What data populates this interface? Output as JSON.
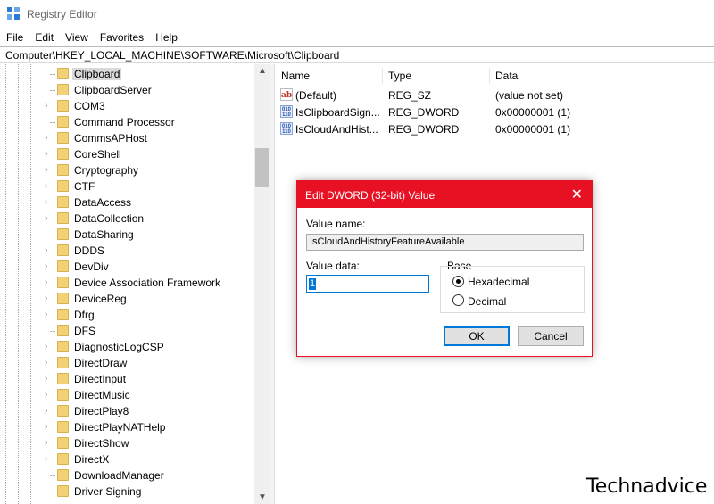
{
  "window": {
    "title": "Registry Editor",
    "icon": "registry-editor-icon"
  },
  "menu": [
    "File",
    "Edit",
    "View",
    "Favorites",
    "Help"
  ],
  "address": "Computer\\HKEY_LOCAL_MACHINE\\SOFTWARE\\Microsoft\\Clipboard",
  "tree": {
    "selected": "Clipboard",
    "items": [
      {
        "label": "Clipboard",
        "expandable": false
      },
      {
        "label": "ClipboardServer",
        "expandable": false
      },
      {
        "label": "COM3",
        "expandable": true
      },
      {
        "label": "Command Processor",
        "expandable": false
      },
      {
        "label": "CommsAPHost",
        "expandable": true
      },
      {
        "label": "CoreShell",
        "expandable": true
      },
      {
        "label": "Cryptography",
        "expandable": true
      },
      {
        "label": "CTF",
        "expandable": true
      },
      {
        "label": "DataAccess",
        "expandable": true
      },
      {
        "label": "DataCollection",
        "expandable": true
      },
      {
        "label": "DataSharing",
        "expandable": false
      },
      {
        "label": "DDDS",
        "expandable": true
      },
      {
        "label": "DevDiv",
        "expandable": true
      },
      {
        "label": "Device Association Framework",
        "expandable": true
      },
      {
        "label": "DeviceReg",
        "expandable": true
      },
      {
        "label": "Dfrg",
        "expandable": true
      },
      {
        "label": "DFS",
        "expandable": false
      },
      {
        "label": "DiagnosticLogCSP",
        "expandable": true
      },
      {
        "label": "DirectDraw",
        "expandable": true
      },
      {
        "label": "DirectInput",
        "expandable": true
      },
      {
        "label": "DirectMusic",
        "expandable": true
      },
      {
        "label": "DirectPlay8",
        "expandable": true
      },
      {
        "label": "DirectPlayNATHelp",
        "expandable": true
      },
      {
        "label": "DirectShow",
        "expandable": true
      },
      {
        "label": "DirectX",
        "expandable": true
      },
      {
        "label": "DownloadManager",
        "expandable": false
      },
      {
        "label": "Driver Signing",
        "expandable": false
      }
    ]
  },
  "values_panel": {
    "columns": [
      "Name",
      "Type",
      "Data"
    ],
    "rows": [
      {
        "icon": "string-value-icon",
        "icon_text": "ab",
        "name": "(Default)",
        "type": "REG_SZ",
        "data": "(value not set)"
      },
      {
        "icon": "dword-value-icon",
        "icon_text": "010 110",
        "name": "IsClipboardSign...",
        "type": "REG_DWORD",
        "data": "0x00000001 (1)"
      },
      {
        "icon": "dword-value-icon",
        "icon_text": "010 110",
        "name": "IsCloudAndHist...",
        "type": "REG_DWORD",
        "data": "0x00000001 (1)"
      }
    ]
  },
  "dialog": {
    "title": "Edit DWORD (32-bit) Value",
    "close": "✕",
    "value_name_label": "Value name:",
    "value_name": "IsCloudAndHistoryFeatureAvailable",
    "value_data_label": "Value data:",
    "value_data": "1",
    "base_label": "Base",
    "base_options": [
      {
        "label": "Hexadecimal",
        "selected": true
      },
      {
        "label": "Decimal",
        "selected": false
      }
    ],
    "ok_label": "OK",
    "cancel_label": "Cancel",
    "accent_color": "#e81123"
  },
  "watermark": "Technadvice"
}
